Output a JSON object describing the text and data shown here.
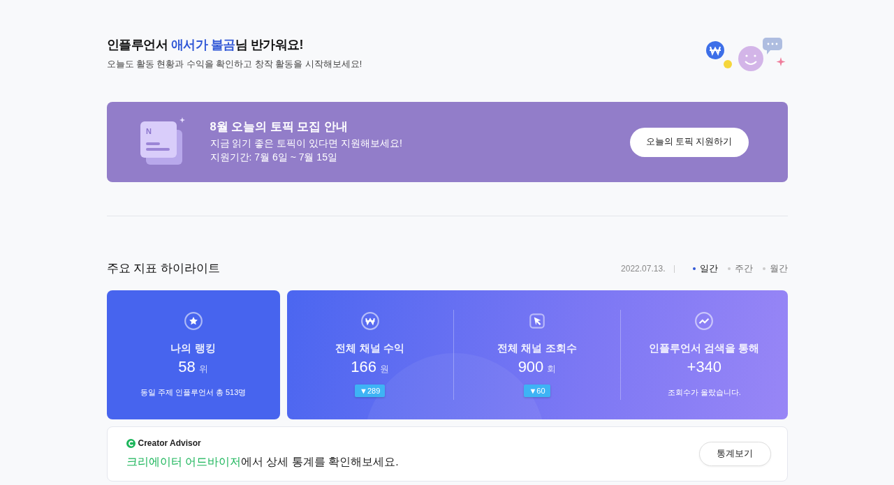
{
  "greeting": {
    "prefix": "인플루언서 ",
    "name": "애서가 불곰",
    "suffix": "님 반가워요!",
    "subtitle": "오늘도 활동 현황과 수익을 확인하고 창작 활동을 시작해보세요!"
  },
  "banner": {
    "icon_letter": "N",
    "title": "8월 오늘의 토픽 모집 안내",
    "lines": [
      "지금 읽기 좋은 토픽이 있다면 지원해보세요!",
      "지원기간: 7월 6일 ~ 7월 15일"
    ],
    "button": "오늘의 토픽 지원하기"
  },
  "highlights": {
    "title": "주요 지표 하이라이트",
    "date": "2022.07.13.",
    "periods": [
      {
        "label": "일간",
        "selected": true
      },
      {
        "label": "주간",
        "selected": false
      },
      {
        "label": "월간",
        "selected": false
      }
    ],
    "ranking": {
      "label": "나의 랭킹",
      "value": "58",
      "unit": "위",
      "note": "동일 주제 인플루언서 총 513명"
    },
    "metrics": [
      {
        "kind": "revenue",
        "label": "전체 채널 수익",
        "value": "166",
        "unit": "원",
        "change": "▼289"
      },
      {
        "kind": "views",
        "label": "전체 채널 조회수",
        "value": "900",
        "unit": "회",
        "change": "▼60"
      },
      {
        "kind": "search",
        "label": "인플루언서 검색을 통해",
        "value": "+340",
        "note": "조회수가 올랐습니다."
      }
    ]
  },
  "advisor": {
    "brand": "Creator Advisor",
    "highlight": "크리에이터 어드바이저",
    "text": "에서 상세 통계를 확인해보세요.",
    "button": "통계보기"
  }
}
